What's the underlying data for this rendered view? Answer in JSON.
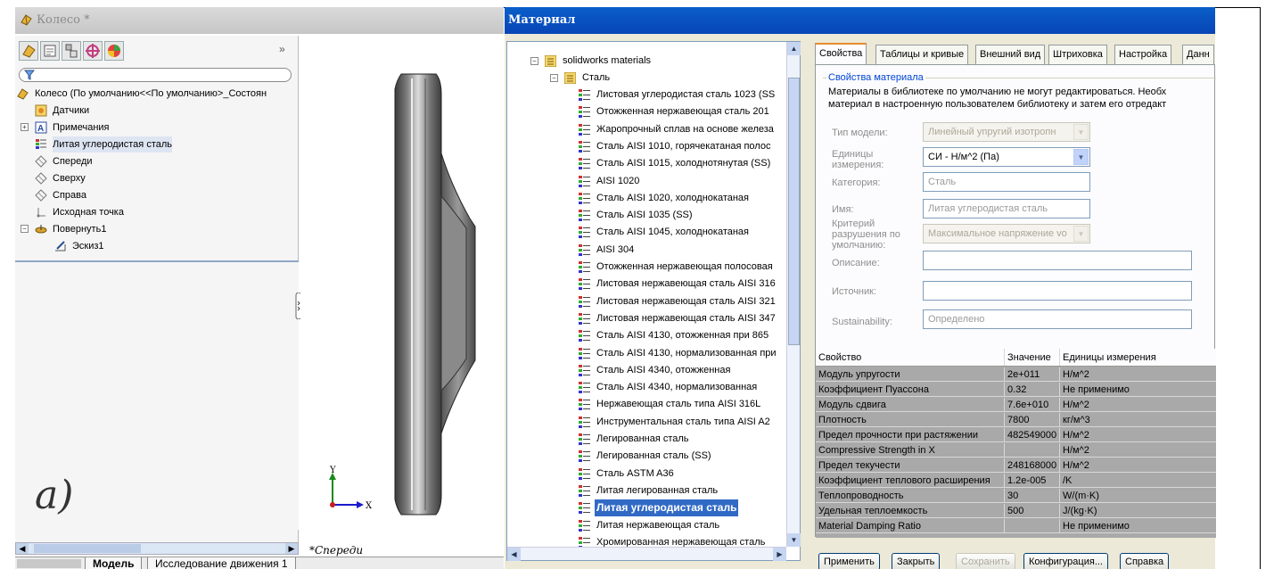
{
  "solidworks": {
    "window_title": "Колесо *",
    "tree": {
      "root": "Колесо  (По умолчанию<<По умолчанию>_Состоян",
      "items": [
        {
          "label": "Датчики"
        },
        {
          "label": "Примечания"
        },
        {
          "label": "Литая углеродистая сталь"
        },
        {
          "label": "Спереди"
        },
        {
          "label": "Сверху"
        },
        {
          "label": "Справа"
        },
        {
          "label": "Исходная точка"
        },
        {
          "label": "Повернуть1"
        },
        {
          "label": "Эскиз1"
        }
      ]
    },
    "figure_label": "а)",
    "view_label": "*Спереди",
    "axis_x": "X",
    "axis_y": "Y",
    "bottom_tabs": [
      "Модель",
      "Исследование движения 1"
    ]
  },
  "material_dialog": {
    "title": "Материал",
    "library_root": "solidworks materials",
    "category": "Сталь",
    "materials": [
      "Листовая углеродистая сталь 1023 (SS",
      "Отожженная нержавеющая сталь 201",
      "Жаропрочный сплав на основе железа",
      "Сталь AISI 1010, горячекатаная полос",
      "Сталь AISI 1015, холоднотянутая (SS)",
      "AISI 1020",
      "Сталь AISI 1020, холоднокатаная",
      "Сталь AISI 1035 (SS)",
      "Сталь AISI 1045, холоднокатаная",
      "AISI 304",
      "Отожженная нержавеющая полосовая",
      "Листовая нержавеющая сталь AISI 316",
      "Листовая нержавеющая сталь AISI 321",
      "Листовая нержавеющая сталь AISI 347",
      "Сталь AISI 4130, отожженная при 865",
      "Сталь AISI 4130, нормализованная при",
      "Сталь AISI 4340, отожженная",
      "Сталь AISI 4340, нормализованная",
      "Нержавеющая сталь типа AISI 316L",
      "Инструментальная сталь типа AISI A2",
      "Легированная сталь",
      "Легированная сталь (SS)",
      "Сталь ASTM A36",
      "Литая легированная сталь",
      "Литая углеродистая сталь",
      "Литая нержавеющая сталь",
      "Хромированная нержавеющая сталь"
    ],
    "selected_material": "Литая углеродистая сталь",
    "tabs": [
      "Свойства",
      "Таблицы и кривые",
      "Внешний вид",
      "Штриховка",
      "Настройка",
      "Данн"
    ],
    "group_title": "Свойства материала",
    "note_line1": "Материалы в библиотеке по умолчанию не могут редактироваться. Необх",
    "note_line2": "материал в настроенную пользователем библиотеку и затем его отредакт",
    "fields": {
      "model_type_label": "Тип модели:",
      "model_type_value": "Линейный упругий изотропн",
      "units_label": "Единицы измерения:",
      "units_value": "СИ - Н/м^2 (Па)",
      "category_label": "Категория:",
      "category_value": "Сталь",
      "name_label": "Имя:",
      "name_value": "Литая углеродистая сталь",
      "criterion_label": "Критерий разрушения по умолчанию:",
      "criterion_value": "Максимальное напряжение vo",
      "description_label": "Описание:",
      "description_value": "",
      "source_label": "Источник:",
      "source_value": "",
      "sustainability_label": "Sustainability:",
      "sustainability_value": "Определено"
    },
    "table_headers": [
      "Свойство",
      "Значение",
      "Единицы измерения"
    ],
    "table_rows": [
      [
        "Модуль упругости",
        "2e+011",
        "Н/м^2"
      ],
      [
        "Коэффициент Пуассона",
        "0.32",
        "Не применимо"
      ],
      [
        "Модуль сдвига",
        "7.6e+010",
        "Н/м^2"
      ],
      [
        "Плотность",
        "7800",
        "кг/м^3"
      ],
      [
        "Предел прочности при растяжении",
        "482549000",
        "Н/м^2"
      ],
      [
        "Compressive Strength in X",
        "",
        "Н/м^2"
      ],
      [
        "Предел текучести",
        "248168000",
        "Н/м^2"
      ],
      [
        "Коэффициент теплового расширения",
        "1.2e-005",
        "/K"
      ],
      [
        "Теплопроводность",
        "30",
        "W/(m·K)"
      ],
      [
        "Удельная теплоемкость",
        "500",
        "J/(kg·K)"
      ],
      [
        "Material Damping Ratio",
        "",
        "Не применимо"
      ]
    ],
    "buttons": {
      "apply": "Применить",
      "close": "Закрыть",
      "save": "Сохранить",
      "config": "Конфигурация...",
      "help": "Справка"
    }
  }
}
